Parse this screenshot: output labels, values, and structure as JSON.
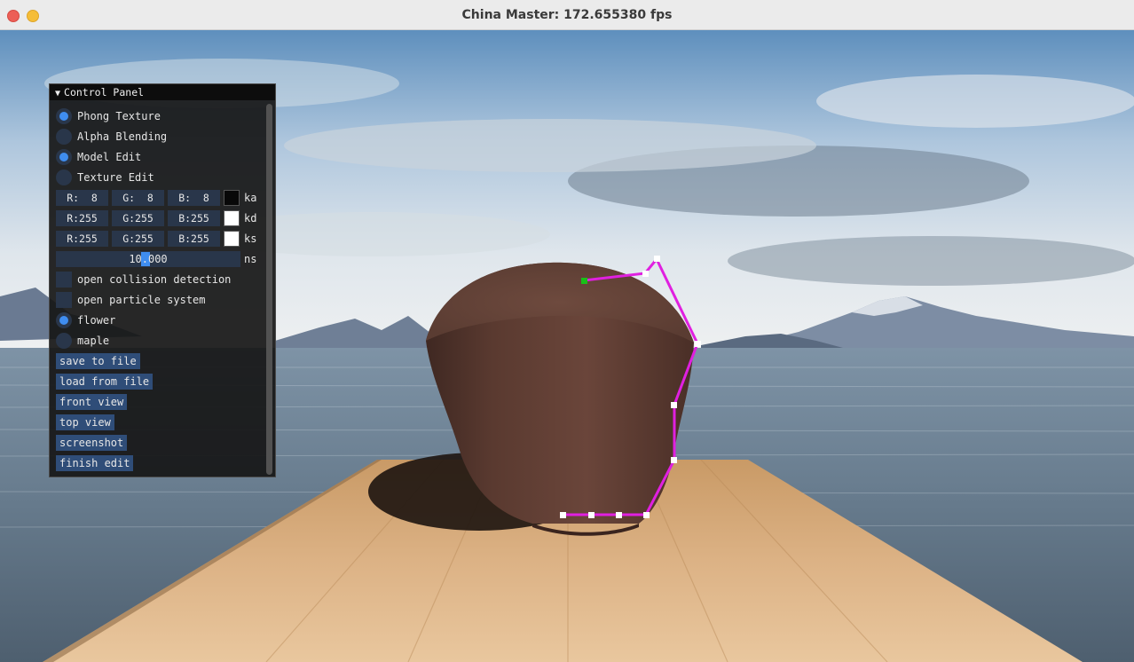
{
  "window": {
    "title": "China Master: 172.655380 fps"
  },
  "control_panel": {
    "header": "Control Panel",
    "render_modes": [
      {
        "label": "Phong Texture",
        "selected": true
      },
      {
        "label": "Alpha Blending",
        "selected": false
      },
      {
        "label": "Model Edit",
        "selected": true
      },
      {
        "label": "Texture Edit",
        "selected": false
      }
    ],
    "color_rows": [
      {
        "r": "R:  8",
        "g": "G:  8",
        "b": "B:  8",
        "swatch": "#080808",
        "label": "ka"
      },
      {
        "r": "R:255",
        "g": "G:255",
        "b": "B:255",
        "swatch": "#ffffff",
        "label": "kd"
      },
      {
        "r": "R:255",
        "g": "G:255",
        "b": "B:255",
        "swatch": "#ffffff",
        "label": "ks"
      }
    ],
    "ns": {
      "value": "10.000",
      "label": "ns"
    },
    "toggles": [
      {
        "label": "open collision detection",
        "checked": false
      },
      {
        "label": "open particle system",
        "checked": false
      }
    ],
    "particle_type": [
      {
        "label": "flower",
        "selected": true
      },
      {
        "label": "maple",
        "selected": false
      }
    ],
    "buttons": [
      "save to file",
      "load from file",
      "front view",
      "top view",
      "screenshot",
      "finish edit"
    ]
  },
  "colors": {
    "accent": "#3f8df0",
    "button_bg": "#2f4d78",
    "frame_bg": "#29364a",
    "control_curve": "#e020e0",
    "selected_control_point": "#19c019"
  }
}
